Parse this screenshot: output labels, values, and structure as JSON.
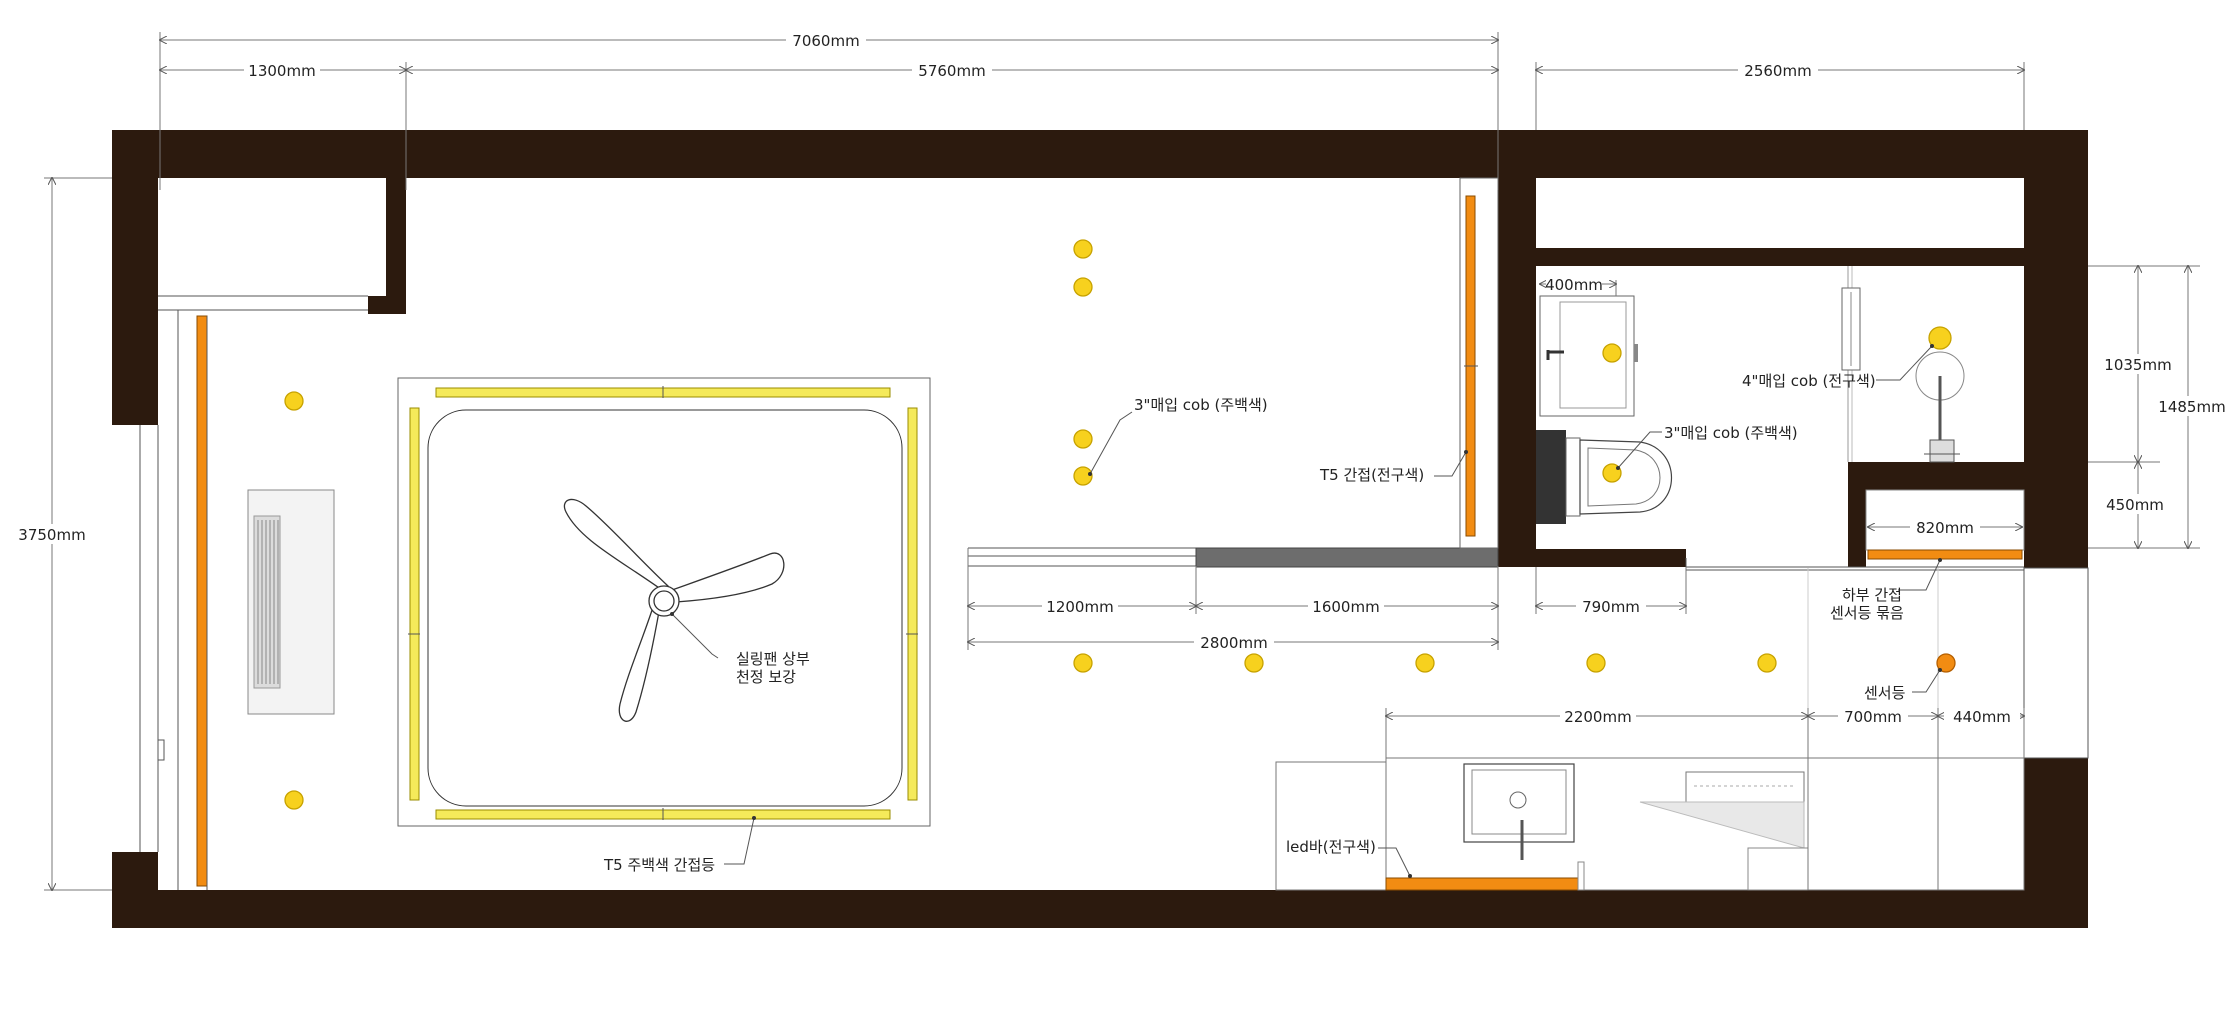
{
  "colors": {
    "wall": "#2c1a0e",
    "light": "#f7d11e",
    "light_stroke": "#c7a200",
    "cove_yellow": "#f5ea5a",
    "cove_orange": "#f28c12",
    "sensor": "#f28c12"
  },
  "dimensions": {
    "total_width": "7060mm",
    "left_width": "1300mm",
    "main_width": "5760mm",
    "right_width": "2560mm",
    "room_height": "3750mm",
    "sink_width": "400mm",
    "bath_height": "1035mm",
    "bath_total": "1485mm",
    "shelf_height": "450mm",
    "shelf_width": "820mm",
    "door_a": "1200mm",
    "door_b": "1600mm",
    "door_total": "2800mm",
    "bath_door": "790mm",
    "counter": "2200mm",
    "fridge": "700mm",
    "closet": "440mm"
  },
  "labels": {
    "cob_3_main": "3\"매입 cob (주백색)",
    "t5_indirect": "T5 간접(전구색)",
    "cob_3_bath": "3\"매입 cob (주백색)",
    "cob_4_bath": "4\"매입 cob (전구색)",
    "fan_line1": "실링팬 상부",
    "fan_line2": "천정 보강",
    "t5_cove": "T5 주백색 간접등",
    "led_bar": "led바(전구색)",
    "lower_line1": "하부 간접",
    "lower_line2": "센서등 묶음",
    "sensor": "센서등"
  }
}
